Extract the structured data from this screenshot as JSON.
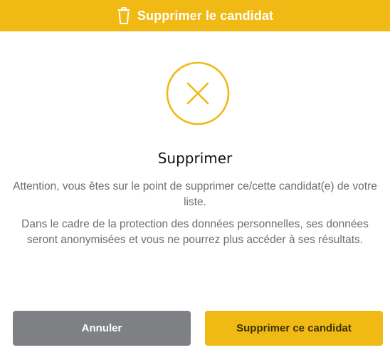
{
  "header": {
    "title": "Supprimer le candidat",
    "icon": "trash-icon"
  },
  "status_icon": "x-circle-icon",
  "heading": "Supprimer",
  "message": {
    "line1": "Attention, vous êtes sur le point de supprimer ce/cette candidat(e) de votre liste.",
    "line2": "Dans le cadre de la protection des données personnelles, ses données seront anonymisées et vous ne pourrez plus accéder à ses résultats."
  },
  "buttons": {
    "cancel_label": "Annuler",
    "confirm_label": "Supprimer ce candidat"
  },
  "colors": {
    "accent": "#f0b913",
    "cancel": "#7f8083",
    "text_muted": "#6d6d6d"
  }
}
